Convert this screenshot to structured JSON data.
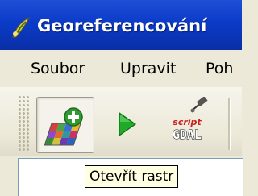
{
  "window": {
    "title": "Georeferencování",
    "app_icon": "georeferencer-icon"
  },
  "menu": {
    "items": [
      {
        "label": "Soubor"
      },
      {
        "label": "Upravit"
      },
      {
        "label": "Poh"
      }
    ]
  },
  "toolbar": {
    "buttons": [
      {
        "icon": "open-raster-icon",
        "state": "pressed"
      },
      {
        "icon": "play-icon"
      },
      {
        "icon": "gdal-script-icon",
        "icon_text_top": "script",
        "icon_text_bottom": "GDAL"
      }
    ]
  },
  "tooltip": {
    "text": "Otevřít rastr"
  },
  "colors": {
    "titlebar": "#0b3bc8",
    "tooltip_bg": "#ffffe1",
    "play_green": "#1faa2a"
  }
}
